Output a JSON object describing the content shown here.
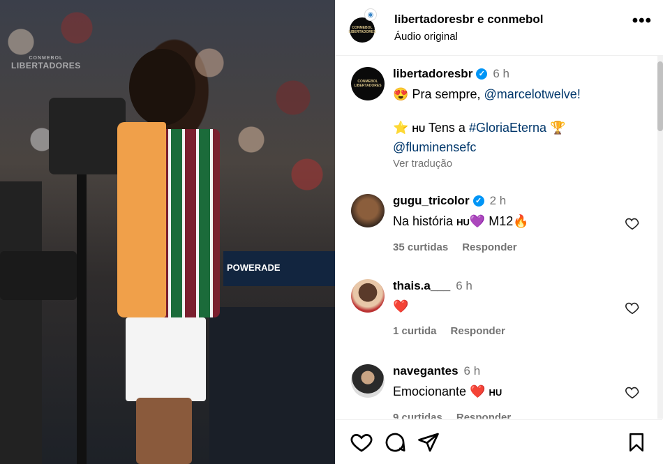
{
  "header": {
    "title": "libertadoresbr e conmebol",
    "subtitle": "Áudio original",
    "more": "•••"
  },
  "media": {
    "watermark": "LIBERTADORES",
    "watermark_small": "CONMEBOL",
    "board_text": "POWERADE"
  },
  "caption": {
    "username": "libertadoresbr",
    "time": "6 h",
    "line1_emoji": "😍",
    "line1_text": "Pra sempre,",
    "line1_mention": "@marcelotwelve!",
    "line2_emoji": "⭐",
    "line2_flag": "HU",
    "line2_text": "Tens a",
    "line2_hashtag": "#GloriaEterna",
    "line2_trophy": "🏆",
    "line3_mention": "@fluminensefc",
    "translate": "Ver tradução"
  },
  "comments": [
    {
      "username": "gugu_tricolor",
      "verified": true,
      "time": "2 h",
      "text_a": "Na história",
      "flag": "HU",
      "emoji_a": "💜",
      "text_b": "M12",
      "emoji_b": "🔥",
      "likes": "35 curtidas",
      "reply": "Responder"
    },
    {
      "username": "thais.a___",
      "verified": false,
      "time": "6 h",
      "emoji": "❤️",
      "likes": "1 curtida",
      "reply": "Responder"
    },
    {
      "username": "navegantes",
      "verified": false,
      "time": "6 h",
      "text": "Emocionante",
      "emoji": "❤️",
      "flag": "HU",
      "likes": "9 curtidas",
      "reply": "Responder"
    }
  ],
  "icons": {
    "like": "heart-icon",
    "comment": "comment-icon",
    "share": "share-icon",
    "save": "bookmark-icon"
  },
  "colors": {
    "verified": "#0095f6",
    "mention": "#00376b",
    "muted": "#737373"
  }
}
